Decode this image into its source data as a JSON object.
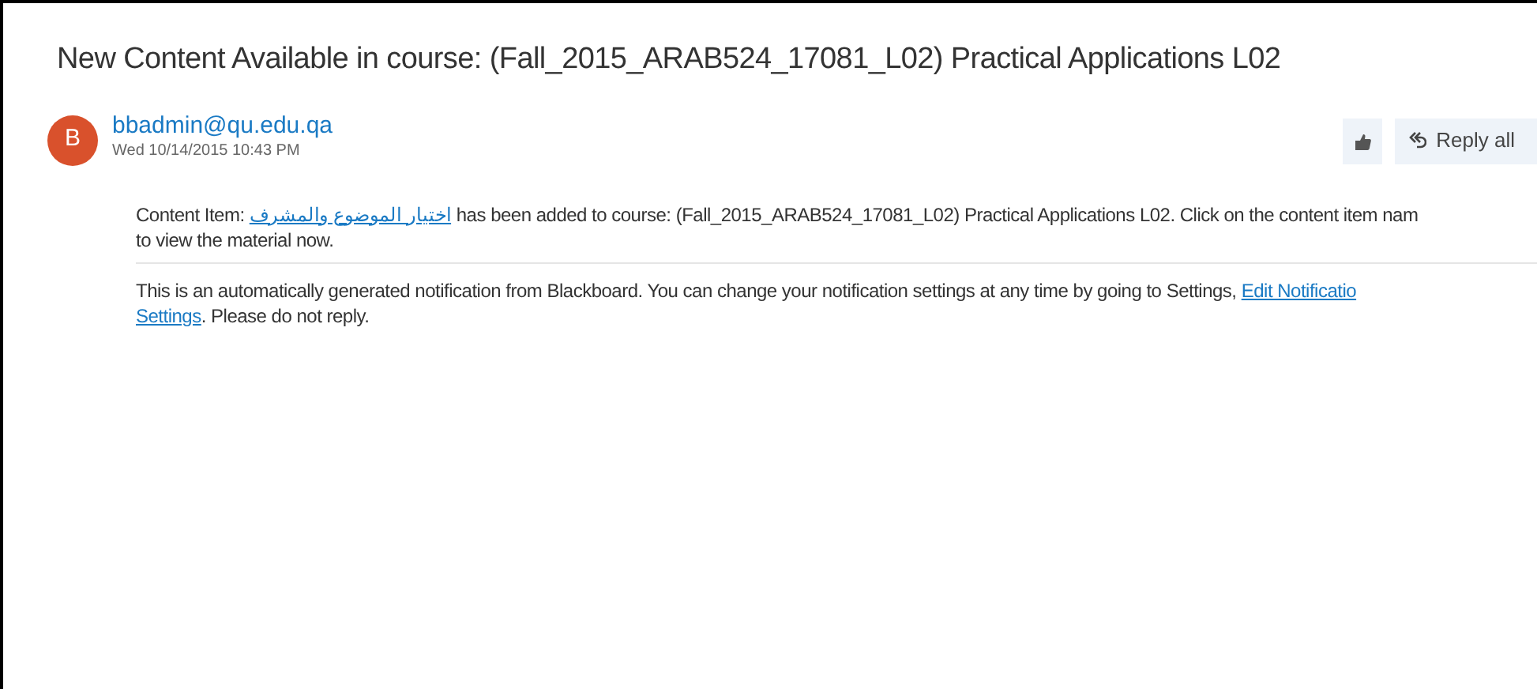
{
  "subject": "New Content Available in course: (Fall_2015_ARAB524_17081_L02) Practical Applications L02",
  "sender": {
    "initial": "B",
    "address": "bbadmin@qu.edu.qa",
    "date": "Wed 10/14/2015 10:43 PM"
  },
  "actions": [
    {
      "kind": "like"
    },
    {
      "kind": "reply_all",
      "label": "Reply all"
    }
  ],
  "body": [
    {
      "prefix": "Content Item: ",
      "link": "اختيار الموضوع والمشرف",
      "suffix": " has been added to course: (Fall_2015_ARAB524_17081_L02) Practical Applications L02. Click on the content item nam",
      "line2": "to view the material now."
    },
    {
      "prefix": "This is an automatically generated notification from Blackboard. You can change your notification settings at any time by going to Settings, ",
      "link": "Edit Notificatio",
      "line2_link": "Settings",
      "line2": ". Please do not reply."
    }
  ]
}
